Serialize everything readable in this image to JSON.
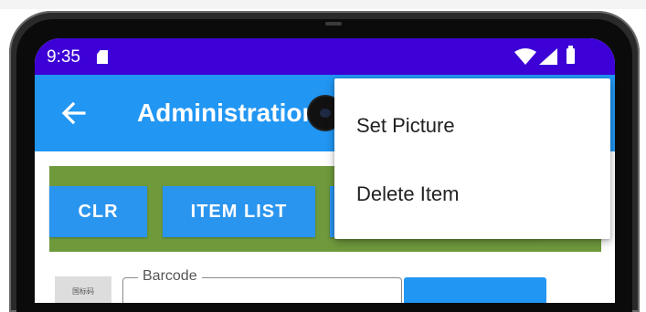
{
  "status_bar": {
    "time": "9:35",
    "icons": [
      "sd-card-icon",
      "wifi-icon",
      "signal-icon",
      "battery-icon"
    ],
    "background_color": "#3d00d6"
  },
  "app_bar": {
    "title": "Administration",
    "back_icon": "arrow-left-icon",
    "background_color": "#2196f3"
  },
  "toolbar": {
    "background_color": "#6f9a3c",
    "buttons": [
      {
        "label": "CLR"
      },
      {
        "label": "ITEM LIST"
      },
      {
        "label": ""
      }
    ]
  },
  "form": {
    "barcode_image_caption": "国标码",
    "barcode_label": "Barcode",
    "barcode_value": ""
  },
  "menu": {
    "items": [
      {
        "label": "Set Picture"
      },
      {
        "label": "Delete Item"
      }
    ]
  }
}
